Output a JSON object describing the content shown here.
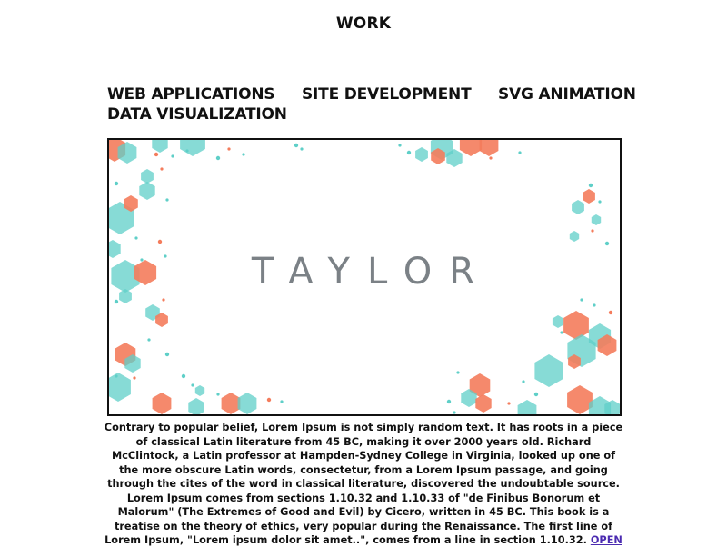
{
  "page": {
    "title": "WORK"
  },
  "nav": {
    "items": [
      {
        "label": "WEB APPLICATIONS"
      },
      {
        "label": "SITE DEVELOPMENT"
      },
      {
        "label": "SVG ANIMATION"
      },
      {
        "label": "DATA VISUALIZATION"
      }
    ]
  },
  "preview": {
    "logo_text": "TAYLOR",
    "colors": {
      "teal": "#5fcfc8",
      "coral": "#f47c5c",
      "overlap": "#6b5a4e",
      "logo": "#7b8186",
      "border": "#111111"
    }
  },
  "project": {
    "description": "Contrary to popular belief, Lorem Ipsum is not simply random text. It has roots in a piece of classical Latin literature from 45 BC, making it over 2000 years old. Richard McClintock, a Latin professor at Hampden-Sydney College in Virginia, looked up one of the more obscure Latin words, consectetur, from a Lorem Ipsum passage, and going through the cites of the word in classical literature, discovered the undoubtable source. Lorem Ipsum comes from sections 1.10.32 and 1.10.33 of \"de Finibus Bonorum et Malorum\" (The Extremes of Good and Evil) by Cicero, written in 45 BC. This book is a treatise on the theory of ethics, very popular during the Renaissance. The first line of Lorem Ipsum, \"Lorem ipsum dolor sit amet..\", comes from a line in section 1.10.32.",
    "open_link": "OPEN SITE"
  }
}
